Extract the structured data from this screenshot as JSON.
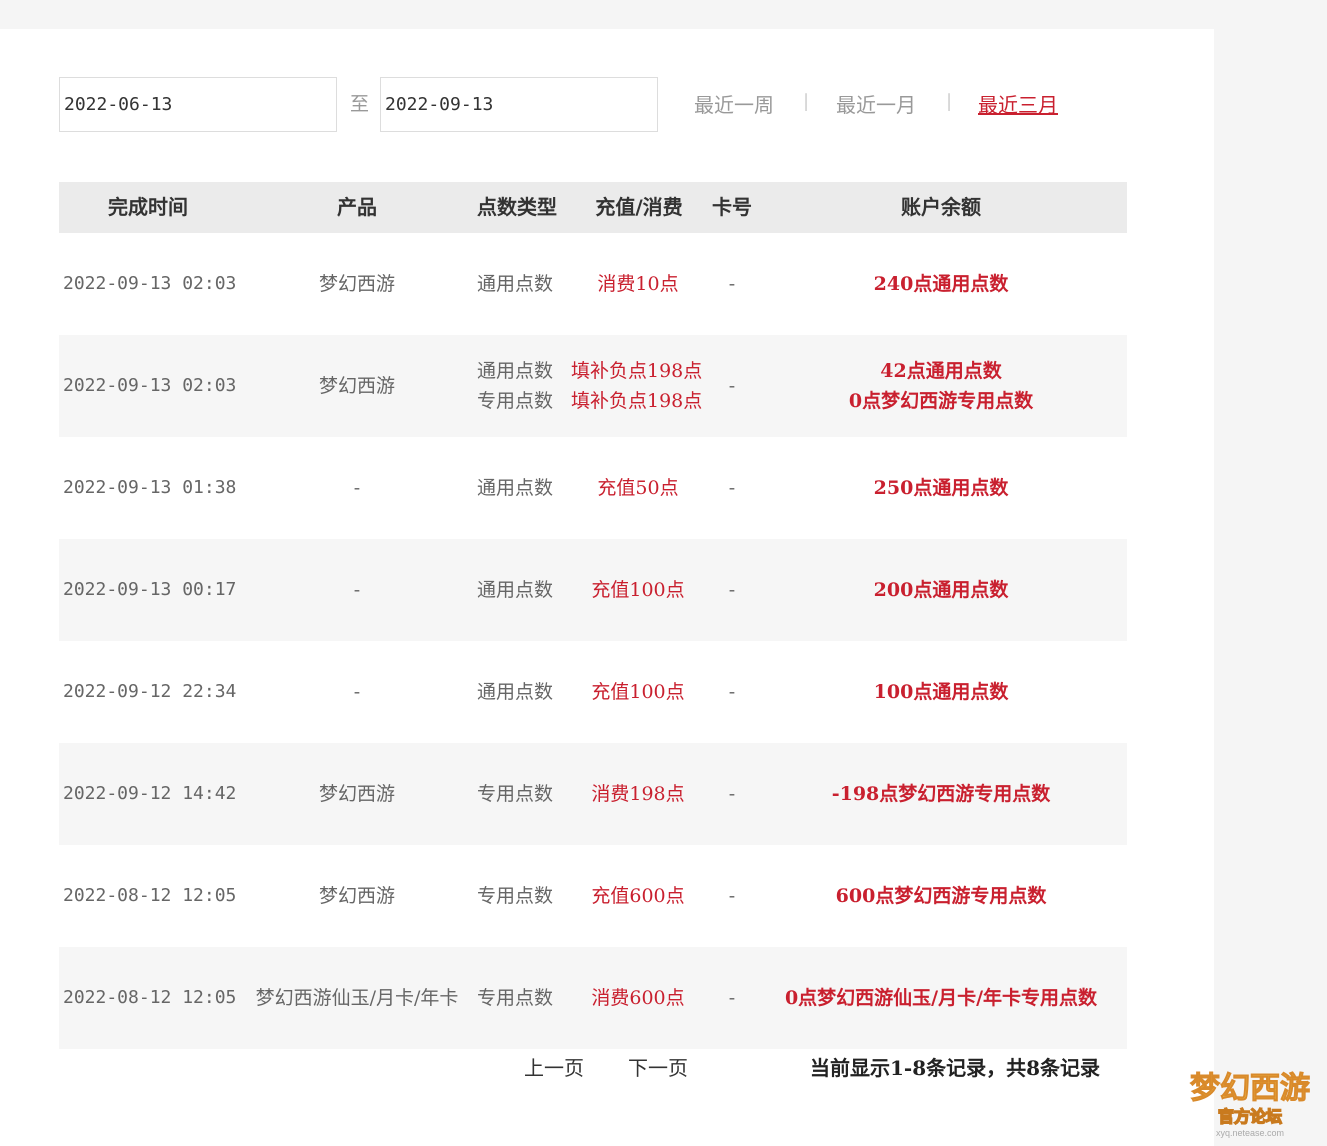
{
  "filter": {
    "date_from": "2022-06-13",
    "to_label": "至",
    "date_to": "2022-09-13",
    "ranges": [
      {
        "label": "最近一周",
        "active": false
      },
      {
        "label": "最近一月",
        "active": false
      },
      {
        "label": "最近三月",
        "active": true
      }
    ],
    "separator": "|"
  },
  "table": {
    "headers": [
      "完成时间",
      "产品",
      "点数类型",
      "充值/消费",
      "卡号",
      "账户余额"
    ],
    "rows": [
      {
        "time": "2022-09-13 02:03",
        "product": "梦幻西游",
        "types": [
          "通用点数"
        ],
        "amounts": [
          "消费10点"
        ],
        "card": "-",
        "balances": [
          "240点通用点数"
        ]
      },
      {
        "time": "2022-09-13 02:03",
        "product": "梦幻西游",
        "types": [
          "通用点数",
          "专用点数"
        ],
        "amounts": [
          "填补负点198点",
          "填补负点198点"
        ],
        "card": "-",
        "balances": [
          "42点通用点数",
          "0点梦幻西游专用点数"
        ]
      },
      {
        "time": "2022-09-13 01:38",
        "product": "-",
        "types": [
          "通用点数"
        ],
        "amounts": [
          "充值50点"
        ],
        "card": "-",
        "balances": [
          "250点通用点数"
        ]
      },
      {
        "time": "2022-09-13 00:17",
        "product": "-",
        "types": [
          "通用点数"
        ],
        "amounts": [
          "充值100点"
        ],
        "card": "-",
        "balances": [
          "200点通用点数"
        ]
      },
      {
        "time": "2022-09-12 22:34",
        "product": "-",
        "types": [
          "通用点数"
        ],
        "amounts": [
          "充值100点"
        ],
        "card": "-",
        "balances": [
          "100点通用点数"
        ]
      },
      {
        "time": "2022-09-12 14:42",
        "product": "梦幻西游",
        "types": [
          "专用点数"
        ],
        "amounts": [
          "消费198点"
        ],
        "card": "-",
        "balances": [
          "-198点梦幻西游专用点数"
        ]
      },
      {
        "time": "2022-08-12 12:05",
        "product": "梦幻西游",
        "types": [
          "专用点数"
        ],
        "amounts": [
          "充值600点"
        ],
        "card": "-",
        "balances": [
          "600点梦幻西游专用点数"
        ]
      },
      {
        "time": "2022-08-12 12:05",
        "product": "梦幻西游仙玉/月卡/年卡",
        "types": [
          "专用点数"
        ],
        "amounts": [
          "消费600点"
        ],
        "card": "-",
        "balances": [
          "0点梦幻西游仙玉/月卡/年卡专用点数"
        ]
      }
    ]
  },
  "pager": {
    "prev_label": "上一页",
    "next_label": "下一页",
    "summary": "当前显示1-8条记录，共8条记录"
  },
  "watermark": {
    "text": "梦幻西游",
    "sub_text": "官方论坛",
    "url": "xyq.netease.com"
  },
  "colors": {
    "accent": "#c9202f",
    "header_bg": "#ebebeb",
    "row_alt_bg": "#f6f6f6",
    "page_bg": "#f5f5f5"
  }
}
